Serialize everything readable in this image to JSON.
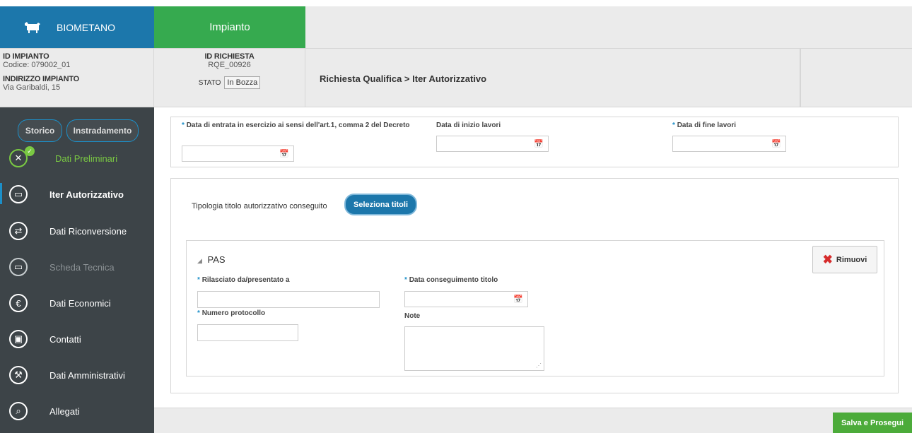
{
  "header": {
    "brand_label": "BIOMETANO",
    "brand_icon": "cow-icon",
    "active_tab": "Impianto"
  },
  "info": {
    "id_impianto_label": "ID IMPIANTO",
    "codice": "Codice: 079002_01",
    "indirizzo_label": "INDIRIZZO IMPIANTO",
    "indirizzo_value": "Via Garibaldi, 15",
    "id_richiesta_label": "ID RICHIESTA",
    "id_richiesta_value": "RQE_00926",
    "stato_label": "STATO",
    "stato_value": "In Bozza",
    "breadcrumb": "Richiesta Qualifica > Iter Autorizzativo"
  },
  "sidebar": {
    "storico": "Storico",
    "instradamento": "Instradamento",
    "items": [
      {
        "label": "Dati Preliminari",
        "icon": "tools-icon",
        "state": "completed"
      },
      {
        "label": "Iter Autorizzativo",
        "icon": "calendar-icon",
        "state": "active"
      },
      {
        "label": "Dati Riconversione",
        "icon": "shuffle-icon",
        "state": "normal"
      },
      {
        "label": "Scheda Tecnica",
        "icon": "document-icon",
        "state": "disabled"
      },
      {
        "label": "Dati Economici",
        "icon": "euro-icon",
        "state": "normal"
      },
      {
        "label": "Contatti",
        "icon": "contacts-icon",
        "state": "normal"
      },
      {
        "label": "Dati Amministrativi",
        "icon": "wrench-icon",
        "state": "normal"
      },
      {
        "label": "Allegati",
        "icon": "paperclip-icon",
        "state": "normal"
      }
    ]
  },
  "form": {
    "data_entrata_label": "Data di entrata in esercizio ai sensi dell'art.1, comma 2 del Decreto",
    "data_inizio_label": "Data di inizio lavori",
    "data_fine_label": "Data di fine lavori",
    "required_mark": "*",
    "tipologia_label": "Tipologia titolo autorizzativo conseguito",
    "seleziona_button": "Seleziona titoli"
  },
  "pas": {
    "title": "PAS",
    "rimuovi_button": "Rimuovi",
    "rilasciato_label": "Rilasciato da/presentato a",
    "numero_protocollo_label": "Numero protocollo",
    "data_conseguimento_label": "Data conseguimento titolo",
    "note_label": "Note"
  },
  "footer": {
    "save_button": "Salva e Prosegui"
  },
  "colors": {
    "brand_blue": "#1c77ab",
    "impianto_green": "#36aa4f",
    "sidebar_bg": "#3d4448",
    "save_green": "#4cab3a",
    "completed_green": "#7ac943",
    "remove_red": "#d62b2b"
  }
}
